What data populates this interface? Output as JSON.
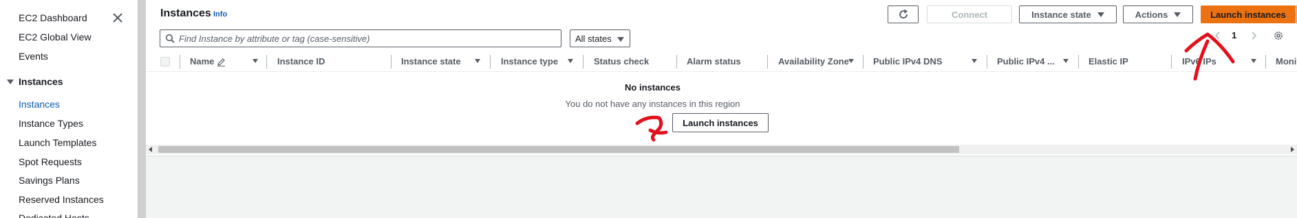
{
  "sidebar": {
    "items": [
      {
        "label": "EC2 Dashboard"
      },
      {
        "label": "EC2 Global View"
      },
      {
        "label": "Events"
      }
    ],
    "group": {
      "label": "Instances"
    },
    "sub_items": [
      {
        "label": "Instances",
        "active": true
      },
      {
        "label": "Instance Types"
      },
      {
        "label": "Launch Templates"
      },
      {
        "label": "Spot Requests"
      },
      {
        "label": "Savings Plans"
      },
      {
        "label": "Reserved Instances"
      },
      {
        "label": "Dedicated Hosts"
      }
    ]
  },
  "header": {
    "title": "Instances",
    "info": "Info"
  },
  "toolbar": {
    "connect": "Connect",
    "instance_state": "Instance state",
    "actions": "Actions",
    "launch": "Launch instances"
  },
  "filter": {
    "placeholder": "Find Instance by attribute or tag (case-sensitive)",
    "states": "All states"
  },
  "pagination": {
    "page": "1"
  },
  "table": {
    "columns": [
      "Name",
      "Instance ID",
      "Instance state",
      "Instance type",
      "Status check",
      "Alarm status",
      "Availability Zone",
      "Public IPv4 DNS",
      "Public IPv4 ...",
      "Elastic IP",
      "IPv6 IPs",
      "Moni"
    ]
  },
  "empty_state": {
    "title": "No instances",
    "message": "You do not have any instances in this region",
    "button": "Launch instances"
  },
  "colors": {
    "accent": "#ec7211",
    "link": "#0f5bb5",
    "annotation": "#e3111b"
  },
  "icons": [
    "close-icon",
    "refresh-icon",
    "search-icon",
    "chevron-left-icon",
    "chevron-right-icon",
    "settings-gear-icon",
    "edit-pencil-icon"
  ]
}
